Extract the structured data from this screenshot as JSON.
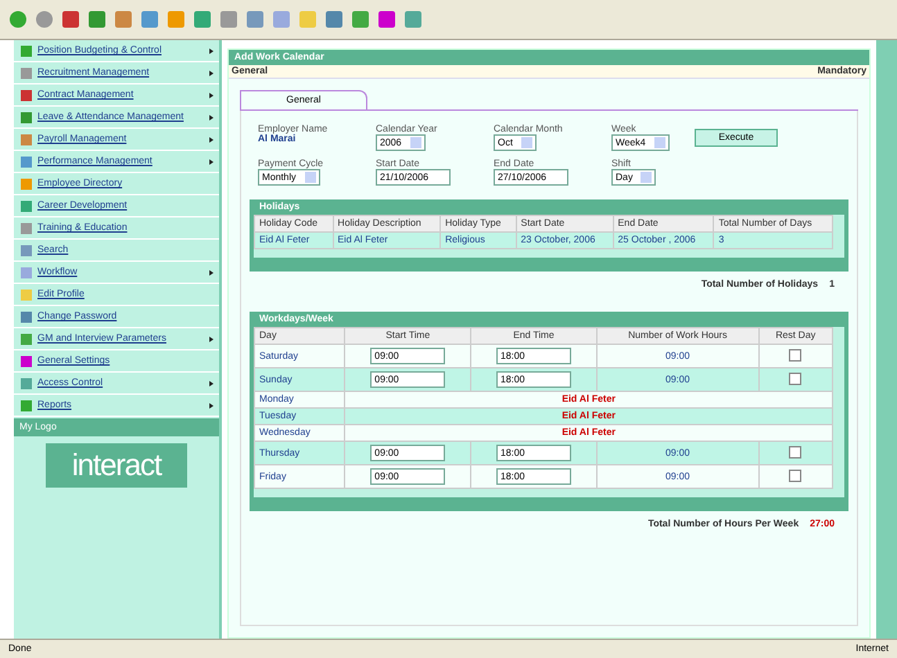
{
  "sidebar": {
    "items": [
      {
        "label": "Position Budgeting & Control",
        "submenu": true
      },
      {
        "label": "Recruitment Management",
        "submenu": true
      },
      {
        "label": "Contract Management",
        "submenu": true
      },
      {
        "label": "Leave & Attendance Management",
        "submenu": true
      },
      {
        "label": "Payroll Management",
        "submenu": true
      },
      {
        "label": "Performance Management",
        "submenu": true
      },
      {
        "label": "Employee Directory",
        "submenu": false
      },
      {
        "label": "Career Development",
        "submenu": false
      },
      {
        "label": "Training & Education",
        "submenu": false
      },
      {
        "label": "Search",
        "submenu": false
      },
      {
        "label": "Workflow",
        "submenu": true
      },
      {
        "label": "Edit Profile",
        "submenu": false
      },
      {
        "label": "Change Password",
        "submenu": false
      },
      {
        "label": "GM and Interview Parameters",
        "submenu": true
      },
      {
        "label": "General Settings",
        "submenu": false
      },
      {
        "label": "Access Control",
        "submenu": true
      },
      {
        "label": "Reports",
        "submenu": true
      }
    ],
    "footer": "My Logo",
    "logo": "interact"
  },
  "page": {
    "title": "Add Work Calendar",
    "section": "General",
    "mandatory": "Mandatory",
    "tabs": [
      {
        "label": "General",
        "selected": true
      }
    ],
    "fields": [
      {
        "kind": "static",
        "label": "Employer Name",
        "value": "Al Marai"
      },
      {
        "kind": "select",
        "label": "Calendar Year",
        "value": "2006"
      },
      {
        "kind": "select",
        "label": "Calendar Month",
        "value": "Oct"
      },
      {
        "kind": "select",
        "label": "Week",
        "value": "Week4"
      },
      {
        "kind": "select",
        "label": "Payment Cycle",
        "value": "Monthly"
      },
      {
        "kind": "text",
        "label": "Start Date",
        "value": "21/10/2006"
      },
      {
        "kind": "text",
        "label": "End Date",
        "value": "27/10/2006"
      },
      {
        "kind": "select",
        "label": "Shift",
        "value": "Day"
      }
    ],
    "execute": "Execute",
    "holidays": {
      "title": "Holidays",
      "columns": [
        "Holiday Code",
        "Holiday Description",
        "Holiday Type",
        "Start Date",
        "End Date",
        "Total Number of Days"
      ],
      "rows": [
        [
          "Eid Al Feter",
          "Eid Al Feter",
          "Religious",
          "23 October, 2006",
          "25 October , 2006",
          "3"
        ]
      ],
      "total_label": "Total Number of Holidays",
      "total": "1"
    },
    "workdays": {
      "title": "Workdays/Week",
      "columns": [
        "Day",
        "Start Time",
        "End Time",
        "Number of Work Hours",
        "Rest Day"
      ],
      "rows": [
        {
          "kind": "work",
          "day": "Saturday",
          "start": "09:00",
          "end": "18:00",
          "hours": "09:00",
          "rest": false
        },
        {
          "kind": "work",
          "day": "Sunday",
          "start": "09:00",
          "end": "18:00",
          "hours": "09:00",
          "rest": false
        },
        {
          "kind": "holiday",
          "day": "Monday",
          "note": "Eid Al Feter"
        },
        {
          "kind": "holiday",
          "day": "Tuesday",
          "note": "Eid Al Feter"
        },
        {
          "kind": "holiday",
          "day": "Wednesday",
          "note": "Eid Al Feter"
        },
        {
          "kind": "work",
          "day": "Thursday",
          "start": "09:00",
          "end": "18:00",
          "hours": "09:00",
          "rest": false
        },
        {
          "kind": "work",
          "day": "Friday",
          "start": "09:00",
          "end": "18:00",
          "hours": "09:00",
          "rest": false
        }
      ],
      "total_label": "Total Number of Hours Per Week",
      "total": "27:00"
    }
  },
  "status_bar": {
    "text": "Done",
    "zone": "Internet"
  }
}
